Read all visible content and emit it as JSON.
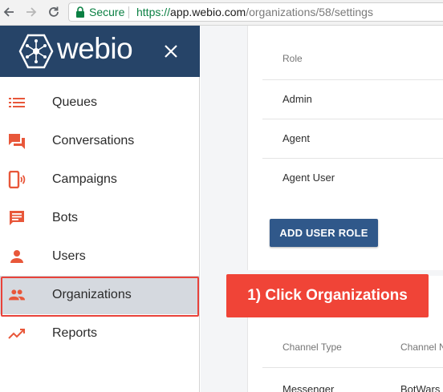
{
  "browser": {
    "secure_label": "Secure",
    "url_scheme": "https://",
    "url_host": "app.webio.com",
    "url_path": "/organizations/58/settings"
  },
  "brand": {
    "name": "webio",
    "header_color": "#264468",
    "accent_color": "#e8573a"
  },
  "sidebar": {
    "items": [
      {
        "label": "Queues",
        "icon": "list-icon"
      },
      {
        "label": "Conversations",
        "icon": "chat-bubbles-icon"
      },
      {
        "label": "Campaigns",
        "icon": "phone-broadcast-icon"
      },
      {
        "label": "Bots",
        "icon": "message-icon"
      },
      {
        "label": "Users",
        "icon": "person-icon"
      },
      {
        "label": "Organizations",
        "icon": "people-icon",
        "active": true
      },
      {
        "label": "Reports",
        "icon": "trending-icon"
      }
    ]
  },
  "roles": {
    "header": "Role",
    "rows": [
      "Admin",
      "Agent",
      "Agent User"
    ],
    "add_button": "ADD USER ROLE"
  },
  "channels": {
    "headers": [
      "Channel Type",
      "Channel N"
    ],
    "rows": [
      [
        "Messenger",
        "BotWars"
      ]
    ]
  },
  "callout": {
    "text": "1) Click Organizations",
    "color": "#f04437"
  }
}
